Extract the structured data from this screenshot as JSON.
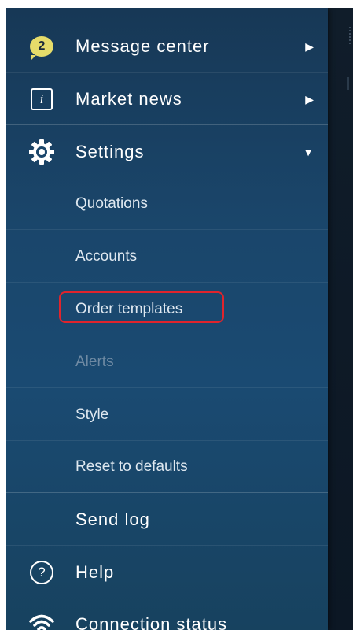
{
  "menu": {
    "message_center": {
      "badge": "2",
      "label": "Message center"
    },
    "market_news": {
      "icon_char": "i",
      "label": "Market news"
    },
    "settings": {
      "label": "Settings"
    },
    "settings_items": [
      "Quotations",
      "Accounts",
      "Order templates",
      "Alerts",
      "Style",
      "Reset to defaults"
    ],
    "send_log": {
      "label": "Send log"
    },
    "help": {
      "icon_char": "?",
      "label": "Help"
    },
    "connection_status": {
      "label": "Connection status"
    }
  },
  "colors": {
    "drawer": "#1a466b",
    "badge": "#e6dc6a",
    "highlight": "#e0242c",
    "disabled_text": "#6f8aa3"
  },
  "icons": {
    "message_center": "speech-bubble-badge-icon",
    "market_news": "info-icon",
    "settings": "gear-icon",
    "help": "help-icon",
    "connection_status": "wifi-icon",
    "expand": "chevron-right-icon",
    "collapse": "caret-down-icon"
  }
}
